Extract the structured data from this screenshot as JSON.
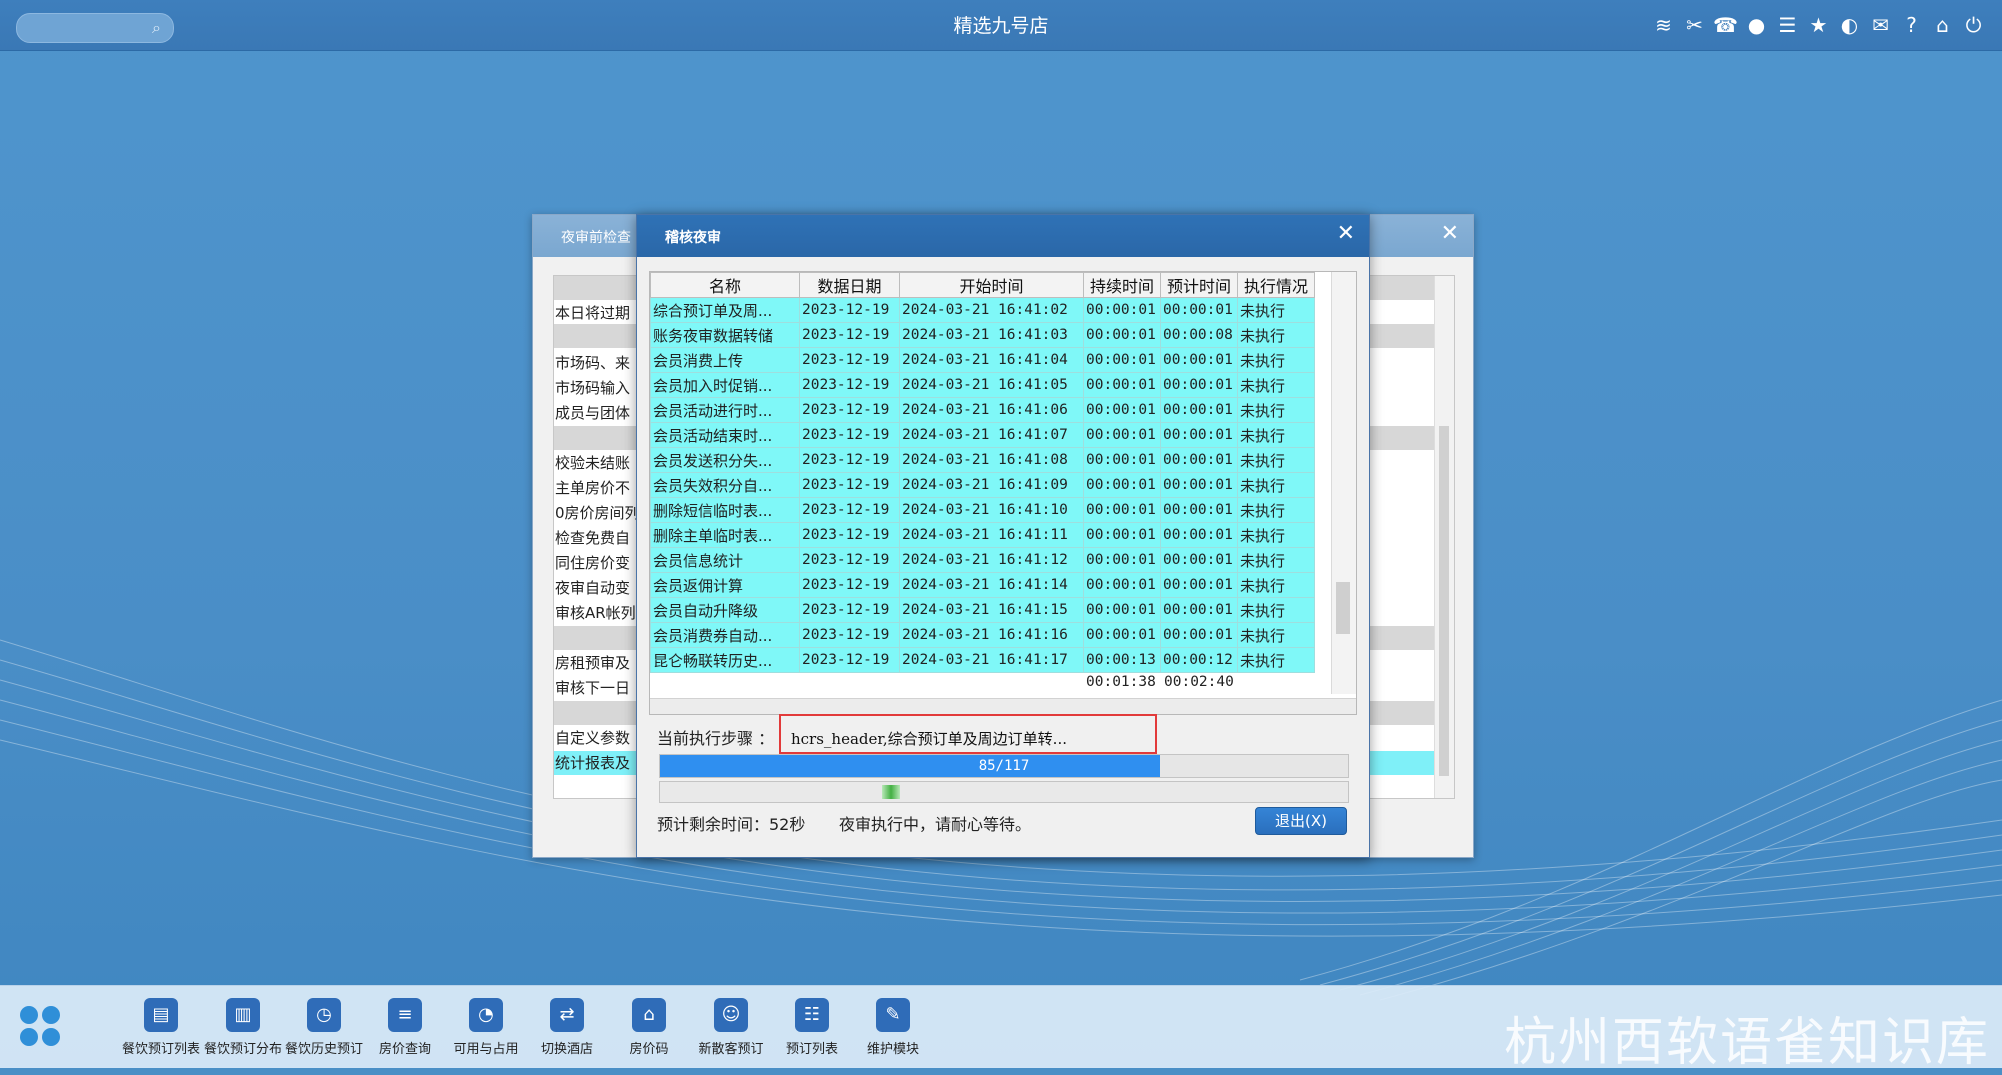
{
  "topbar": {
    "title": "精选九号店",
    "icons": [
      "wifi-icon",
      "tools-icon",
      "phone-icon",
      "palette-icon",
      "menu-icon",
      "star-icon",
      "theme-icon",
      "mail-icon",
      "help-icon",
      "home-icon",
      "power-icon"
    ]
  },
  "back_window": {
    "title": "夜审前检查",
    "rows": [
      {
        "text": "本日将过期",
        "band": false
      },
      {
        "text": "市场码、来",
        "band": false
      },
      {
        "text": "市场码输入",
        "band": false
      },
      {
        "text": "成员与团体",
        "band": false
      },
      {
        "text": "校验未结账",
        "band": false
      },
      {
        "text": "主单房价不",
        "band": false
      },
      {
        "text": "0房价房间列",
        "band": false
      },
      {
        "text": "检查免费自",
        "band": false
      },
      {
        "text": "同住房价变",
        "band": false
      },
      {
        "text": "夜审自动变",
        "band": false
      },
      {
        "text": "审核AR帐列",
        "band": false
      },
      {
        "text": "房租预审及",
        "band": false
      },
      {
        "text": "审核下一日",
        "band": false
      },
      {
        "text": "自定义参数",
        "band": false
      },
      {
        "text": "统计报表及",
        "band": false
      }
    ]
  },
  "dialog": {
    "title": "稽核夜审",
    "columns": [
      "名称",
      "数据日期",
      "开始时间",
      "持续时间",
      "预计时间",
      "执行情况"
    ],
    "rows": [
      [
        "综合预订单及周...",
        "2023-12-19",
        "2024-03-21 16:41:02",
        "00:00:01",
        "00:00:01",
        "未执行"
      ],
      [
        "账务夜审数据转储",
        "2023-12-19",
        "2024-03-21 16:41:03",
        "00:00:01",
        "00:00:08",
        "未执行"
      ],
      [
        "会员消费上传",
        "2023-12-19",
        "2024-03-21 16:41:04",
        "00:00:01",
        "00:00:01",
        "未执行"
      ],
      [
        "会员加入时促销...",
        "2023-12-19",
        "2024-03-21 16:41:05",
        "00:00:01",
        "00:00:01",
        "未执行"
      ],
      [
        "会员活动进行时...",
        "2023-12-19",
        "2024-03-21 16:41:06",
        "00:00:01",
        "00:00:01",
        "未执行"
      ],
      [
        "会员活动结束时...",
        "2023-12-19",
        "2024-03-21 16:41:07",
        "00:00:01",
        "00:00:01",
        "未执行"
      ],
      [
        "会员发送积分失...",
        "2023-12-19",
        "2024-03-21 16:41:08",
        "00:00:01",
        "00:00:01",
        "未执行"
      ],
      [
        "会员失效积分自...",
        "2023-12-19",
        "2024-03-21 16:41:09",
        "00:00:01",
        "00:00:01",
        "未执行"
      ],
      [
        "删除短信临时表...",
        "2023-12-19",
        "2024-03-21 16:41:10",
        "00:00:01",
        "00:00:01",
        "未执行"
      ],
      [
        "删除主单临时表...",
        "2023-12-19",
        "2024-03-21 16:41:11",
        "00:00:01",
        "00:00:01",
        "未执行"
      ],
      [
        "会员信息统计",
        "2023-12-19",
        "2024-03-21 16:41:12",
        "00:00:01",
        "00:00:01",
        "未执行"
      ],
      [
        "会员返佣计算",
        "2023-12-19",
        "2024-03-21 16:41:14",
        "00:00:01",
        "00:00:01",
        "未执行"
      ],
      [
        "会员自动升降级",
        "2023-12-19",
        "2024-03-21 16:41:15",
        "00:00:01",
        "00:00:01",
        "未执行"
      ],
      [
        "会员消费券自动...",
        "2023-12-19",
        "2024-03-21 16:41:16",
        "00:00:01",
        "00:00:01",
        "未执行"
      ],
      [
        "昆仑畅联转历史...",
        "2023-12-19",
        "2024-03-21 16:41:17",
        "00:00:13",
        "00:00:12",
        "未执行"
      ]
    ],
    "total_duration": "00:01:38",
    "total_estimate": "00:02:40",
    "step_label": "当前执行步骤 ：",
    "step_value": "hcrs_header,综合预订单及周边订单转...",
    "progress_text": "85/117",
    "progress_fraction": 0.7265,
    "eta_text": "预计剩余时间：52秒",
    "status_text": "夜审执行中，请耐心等待。",
    "exit_label": "退出(X)"
  },
  "taskbar": {
    "items": [
      {
        "label": "餐饮预订列表",
        "icon": "clipboard-icon"
      },
      {
        "label": "餐饮预订分布",
        "icon": "chart-icon"
      },
      {
        "label": "餐饮历史预订",
        "icon": "clock-icon"
      },
      {
        "label": "房价查询",
        "icon": "coins-icon"
      },
      {
        "label": "可用与占用",
        "icon": "pie-icon"
      },
      {
        "label": "切换酒店",
        "icon": "switch-icon"
      },
      {
        "label": "房价码",
        "icon": "house-icon"
      },
      {
        "label": "新散客预订",
        "icon": "user-add-icon"
      },
      {
        "label": "预订列表",
        "icon": "list-icon"
      },
      {
        "label": "维护模块",
        "icon": "wrench-icon"
      }
    ],
    "watermark": "杭州西软语雀知识库"
  }
}
